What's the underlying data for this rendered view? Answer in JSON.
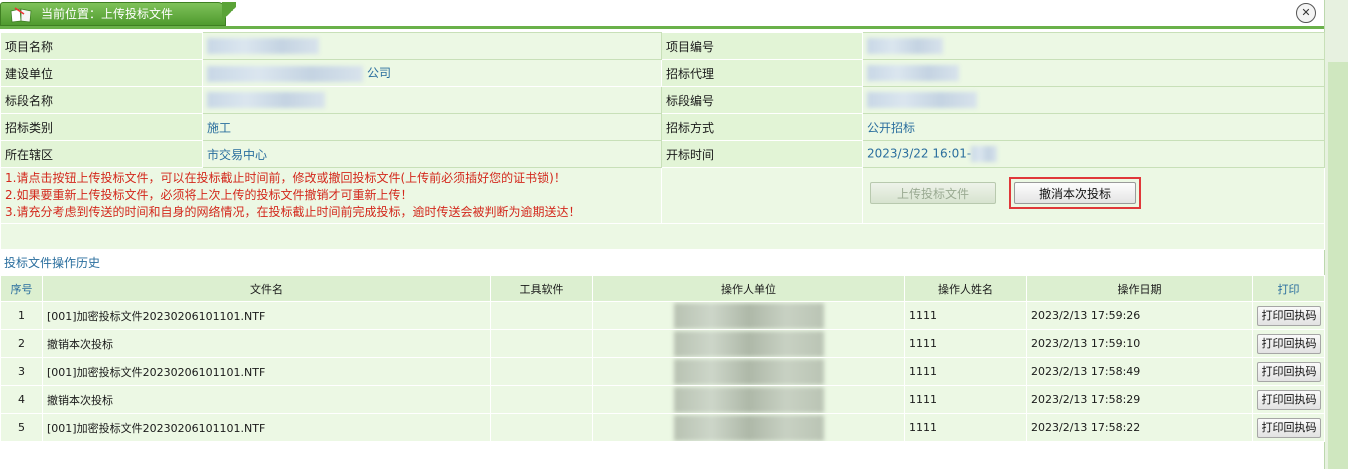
{
  "window": {
    "title": "当前位置：上传投标文件",
    "close_symbol": "✕"
  },
  "info": {
    "project_name_label": "项目名称",
    "project_no_label": "项目编号",
    "builder_label": "建设单位",
    "builder_suffix": "公司",
    "agent_label": "招标代理",
    "section_name_label": "标段名称",
    "section_no_label": "标段编号",
    "category_label": "招标类别",
    "category_value": "施工",
    "method_label": "招标方式",
    "method_value": "公开招标",
    "district_label": "所在辖区",
    "district_value": "市交易中心",
    "open_time_label": "开标时间",
    "open_time_value": "2023/3/22 16:01-"
  },
  "notes": [
    "1.请点击按钮上传投标文件，可以在投标截止时间前，修改或撤回投标文件(上传前必须插好您的证书锁)！",
    "2.如果要重新上传投标文件，必须将上次上传的投标文件撤销才可重新上传！",
    "3.请充分考虑到传送的时间和自身的网络情况，在投标截止时间前完成投标，逾时传送会被判断为逾期送达！"
  ],
  "buttons": {
    "upload_label": "上传投标文件",
    "cancel_label": "撤消本次投标"
  },
  "history": {
    "title": "投标文件操作历史",
    "columns": [
      "序号",
      "文件名",
      "工具软件",
      "操作人单位",
      "操作人姓名",
      "操作日期",
      "打印"
    ],
    "print_label": "打印回执码",
    "rows": [
      {
        "no": "1",
        "file": "[001]加密投标文件20230206101101.NTF",
        "tool": "",
        "operator": "1111",
        "date": "2023/2/13 17:59:26"
      },
      {
        "no": "2",
        "file": "撤销本次投标",
        "tool": "",
        "operator": "1111",
        "date": "2023/2/13 17:59:10"
      },
      {
        "no": "3",
        "file": "[001]加密投标文件20230206101101.NTF",
        "tool": "",
        "operator": "1111",
        "date": "2023/2/13 17:58:49"
      },
      {
        "no": "4",
        "file": "撤销本次投标",
        "tool": "",
        "operator": "1111",
        "date": "2023/2/13 17:58:29"
      },
      {
        "no": "5",
        "file": "[001]加密投标文件20230206101101.NTF",
        "tool": "",
        "operator": "1111",
        "date": "2023/2/13 17:58:22"
      }
    ]
  }
}
